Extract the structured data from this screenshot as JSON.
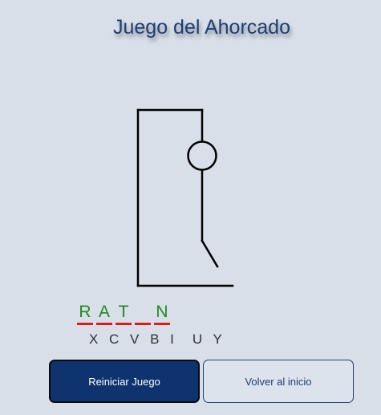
{
  "title": "Juego del Ahorcado",
  "word": {
    "slots": [
      "R",
      "A",
      "T",
      "",
      "N"
    ]
  },
  "wrong_letters": "X C V B I  U Y",
  "buttons": {
    "restart": "Reiniciar Juego",
    "home": "Volver al inicio"
  },
  "hangman_parts_drawn": [
    "head",
    "body",
    "right-leg"
  ],
  "colors": {
    "correct_letter": "#1e8a1e",
    "slot_underline": "#e11b1b",
    "primary_button": "#0e336e",
    "title": "#1d3f73"
  }
}
